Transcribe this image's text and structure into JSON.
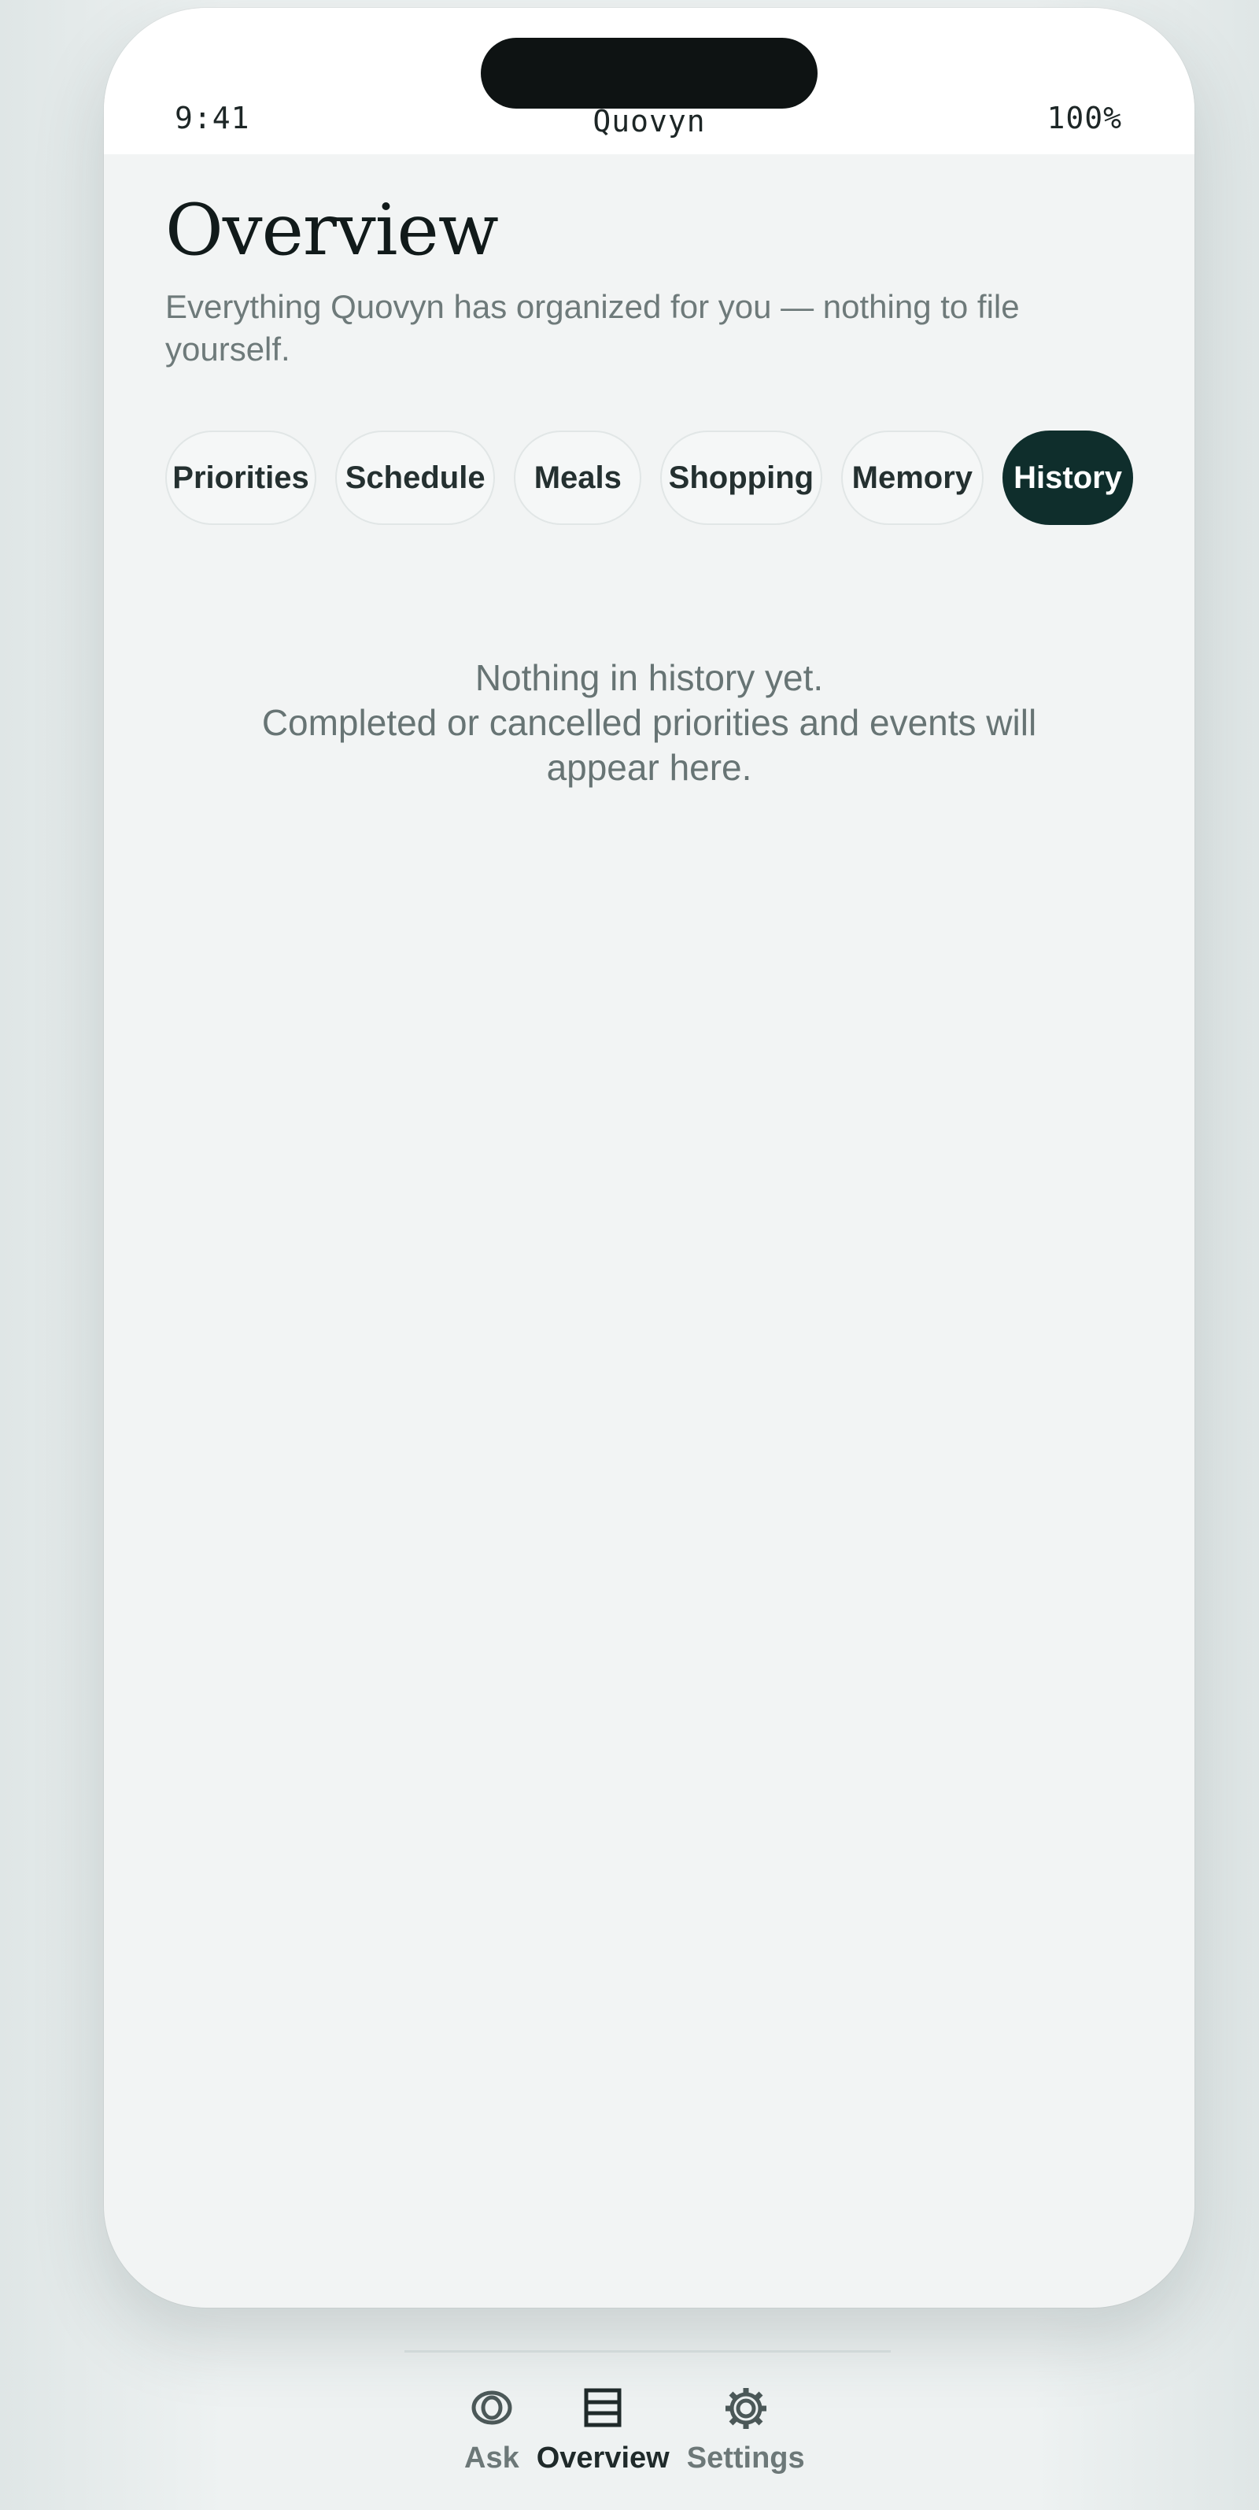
{
  "status_bar": {
    "time": "9:41",
    "app_name": "Quovyn",
    "battery": "100%"
  },
  "page": {
    "title": "Overview",
    "subtitle": "Everything Quovyn has organized for you — nothing to file yourself."
  },
  "tabs": [
    {
      "label": "Priorities",
      "active": false
    },
    {
      "label": "Schedule",
      "active": false
    },
    {
      "label": "Meals",
      "active": false
    },
    {
      "label": "Shopping",
      "active": false
    },
    {
      "label": "Memory",
      "active": false
    },
    {
      "label": "History",
      "active": true
    }
  ],
  "empty_state": {
    "heading": "Nothing in history yet.",
    "message": "Completed or cancelled priorities and events will appear here."
  },
  "bottom_nav": [
    {
      "label": "Ask",
      "icon": "ask-icon",
      "active": false
    },
    {
      "label": "Overview",
      "icon": "overview-list-icon",
      "active": true
    },
    {
      "label": "Settings",
      "icon": "gear-icon",
      "active": false
    }
  ],
  "colors": {
    "accent_dark_teal": "#0f2e2c",
    "background": "#f2f4f4",
    "muted_text": "#6e7a7a"
  }
}
